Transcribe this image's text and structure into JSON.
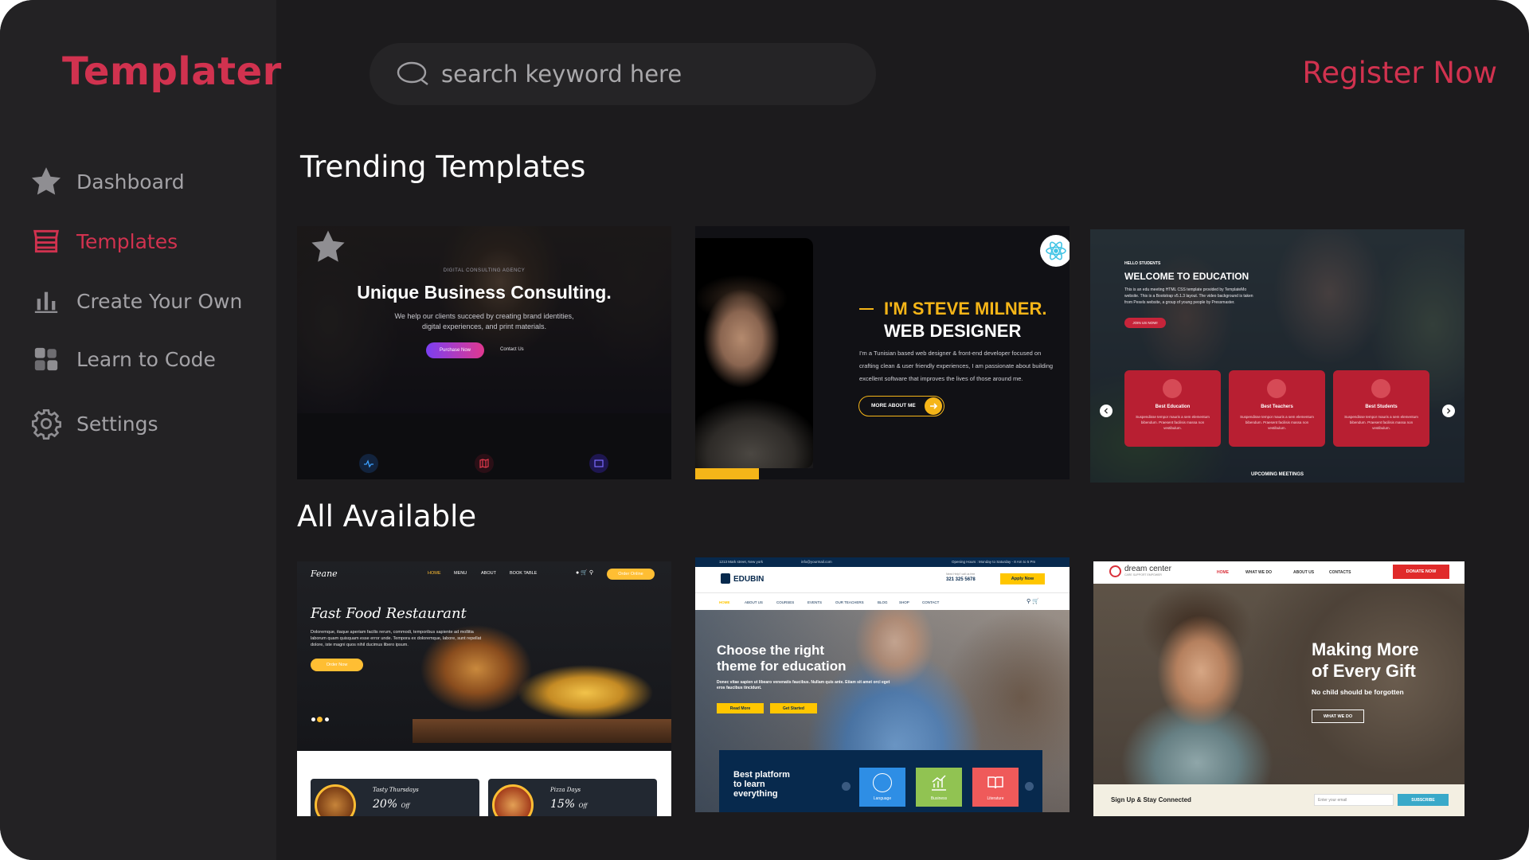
{
  "brand": {
    "name": "Templater",
    "color": "#d1324f"
  },
  "search": {
    "placeholder": "search keyword here",
    "value": ""
  },
  "header": {
    "register_label": "Register Now"
  },
  "sidebar": {
    "items": [
      {
        "label": "Dashboard",
        "icon": "star-icon",
        "active": false
      },
      {
        "label": "Templates",
        "icon": "storefront-icon",
        "active": true
      },
      {
        "label": "Create Your Own",
        "icon": "bar-chart-icon",
        "active": false
      },
      {
        "label": "Learn to Code",
        "icon": "blocks-icon",
        "active": false
      },
      {
        "label": "Settings",
        "icon": "gear-icon",
        "active": false
      }
    ]
  },
  "sections": {
    "trending": "Trending Templates",
    "all": "All Available"
  },
  "trending": [
    {
      "name": "business",
      "small_label": "DIGITAL CONSULTING AGENCY",
      "title": "Unique Business Consulting.",
      "desc1": "We help our clients succeed by creating brand identities,",
      "desc2": "digital experiences, and print materials.",
      "primary": "Purchase Now",
      "secondary": "Contact Us"
    },
    {
      "name": "portfolio",
      "title1": "I'M STEVE MILNER.",
      "title2": "WEB DESIGNER",
      "desc1": "I'm a Tunisian based web designer & front-end developer focused on",
      "desc2": "crafting clean & user friendly experiences, I am passionate about building",
      "desc3": "excellent software that improves the lives of those around me.",
      "button": "MORE ABOUT ME"
    },
    {
      "name": "education",
      "small_label": "HELLO STUDENTS",
      "title": "WELCOME TO EDUCATION",
      "desc": "This is an edu meeting HTML CSS template provided by TemplateMo website. This is a Bootstrap v5.1.3 layout. The video background is taken from Pexels website, a group of young people by Pressmaster.",
      "button": "JOIN US NOW!",
      "boxes": [
        "Best Education",
        "Best Teachers",
        "Best Students"
      ],
      "box_text": "Suspendisse tempor mauris a sem elementum bibendum. Praesent facilisis massa non vestibulum.",
      "footer": "UPCOMING MEETINGS"
    }
  ],
  "available": [
    {
      "name": "feane",
      "logo": "Feane",
      "nav": [
        "HOME",
        "MENU",
        "ABOUT",
        "BOOK TABLE"
      ],
      "order": "Order Online",
      "title": "Fast Food Restaurant",
      "desc": "Doloremque, itaque aperiam facilis rerum, commodi, temporibus sapiente ad mollitia laborum quam quisquam esse error unde. Tempora ex doloremque, labore, sunt repellat dolore, iste magni quos nihil ducimus libero ipsum.",
      "button": "Order Now",
      "offers": [
        {
          "title": "Tasty Thursdays",
          "value": "20%",
          "unit": "Off"
        },
        {
          "title": "Pizza Days",
          "value": "15%",
          "unit": "Off"
        }
      ]
    },
    {
      "name": "edubin",
      "top_left": "1213 Mark street, New york",
      "top_mail": "info@yourmail.com",
      "top_right": "Opening Hours : Monday to Saturday - 8 Am to 5 Pm",
      "logo": "EDUBIN",
      "phone_label": "Need Help? call us free",
      "phone": "321 325 5678",
      "apply": "Apply Now",
      "nav": [
        "HOME",
        "ABOUT US",
        "COURSES",
        "EVENTS",
        "OUR TEACHERS",
        "BLOG",
        "SHOP",
        "CONTACT"
      ],
      "hero1": "Choose the right",
      "hero2": "theme for education",
      "hero_desc": "Donec vitae sapien ut libearo venenatis faucibus. Nullam quis ante. Etiam sit amet orci eget eros faucibus tincidunt.",
      "btn1": "Read More",
      "btn2": "Get Started",
      "panel": [
        "Best platform",
        "to learn",
        "everything"
      ],
      "tiles": [
        "Language",
        "Business",
        "Literature"
      ]
    },
    {
      "name": "dream",
      "logo": "dream center",
      "logo_sub": "CARE SUPPORT EMPOWER",
      "nav": [
        "HOME",
        "WHAT WE DO",
        "ABOUT US",
        "CONTACTS"
      ],
      "donate": "DONATE NOW",
      "title1": "Making More",
      "title2": "of Every Gift",
      "sub": "No child should be forgotten",
      "button": "WHAT WE DO",
      "signup": "Sign Up & Stay Connected",
      "email_ph": "Enter your email",
      "subscribe": "SUBSCRIBE"
    }
  ]
}
